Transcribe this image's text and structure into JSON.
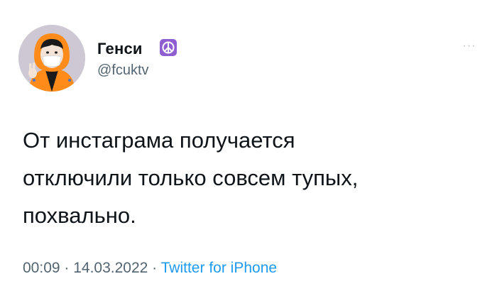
{
  "author": {
    "display_name": "Генси",
    "handle": "@fcuktv",
    "badge_icon": "peace-symbol-icon",
    "badge_color": "#8f5fd1",
    "avatar": "profile-avatar"
  },
  "more_button_label": "···",
  "tweet": {
    "text": "От инстаграма получается\nотключили только совсем тупых,\nпохвально."
  },
  "meta": {
    "time": "00:09",
    "separator": " · ",
    "date": "14.03.2022",
    "source": "Twitter for iPhone"
  },
  "colors": {
    "text": "#0f1419",
    "secondary": "#536471",
    "link": "#1d9bf0"
  }
}
